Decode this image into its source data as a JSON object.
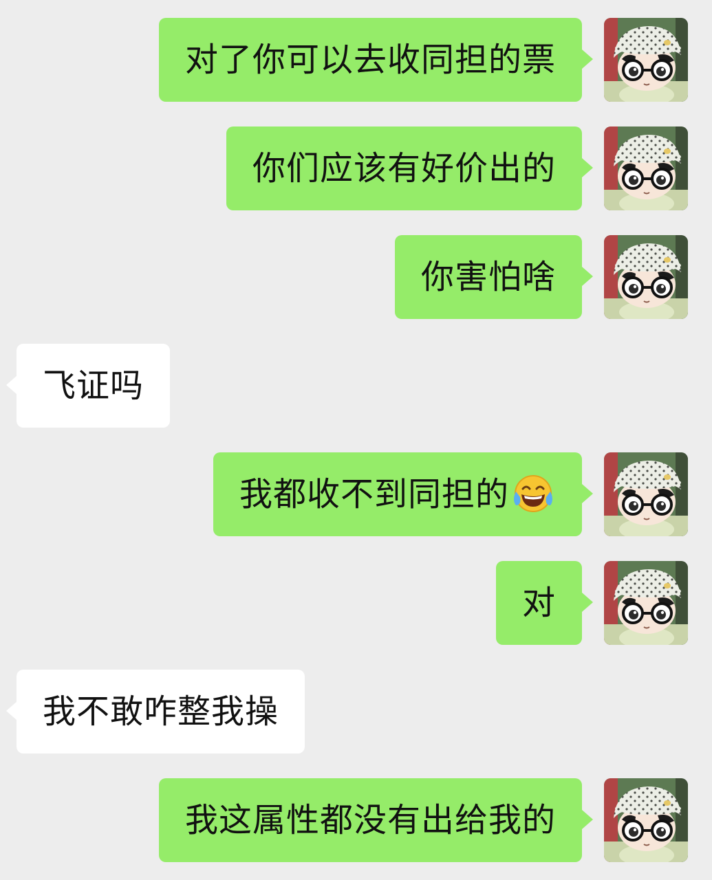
{
  "colors": {
    "background": "#ededed",
    "outgoing_bubble": "#95ec69",
    "incoming_bubble": "#ffffff",
    "text": "#111111"
  },
  "messages": [
    {
      "direction": "outgoing",
      "text": "对了你可以去收同担的票",
      "avatar": "plush-doll-avatar"
    },
    {
      "direction": "outgoing",
      "text": "你们应该有好价出的",
      "avatar": "plush-doll-avatar"
    },
    {
      "direction": "outgoing",
      "text": "你害怕啥",
      "avatar": "plush-doll-avatar"
    },
    {
      "direction": "incoming",
      "text": "飞证吗"
    },
    {
      "direction": "outgoing",
      "text": "我都收不到同担的",
      "emoji": "tears-of-joy-emoji",
      "avatar": "plush-doll-avatar"
    },
    {
      "direction": "outgoing",
      "text": "对",
      "avatar": "plush-doll-avatar"
    },
    {
      "direction": "incoming",
      "text": "我不敢咋整我操"
    },
    {
      "direction": "outgoing",
      "text": "我这属性都没有出给我的",
      "avatar": "plush-doll-avatar"
    }
  ]
}
